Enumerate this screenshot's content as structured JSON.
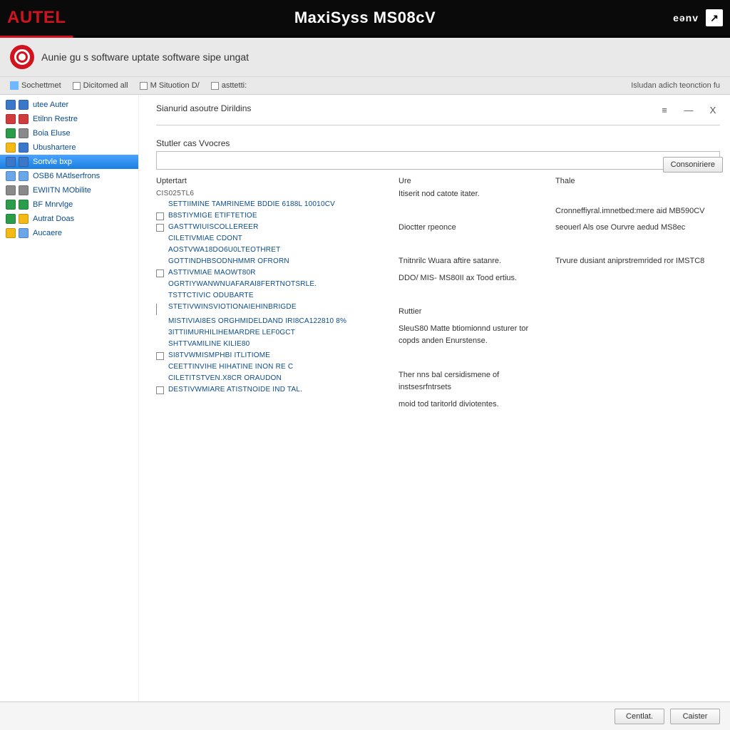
{
  "topbar": {
    "brand": "AUTEL",
    "title": "MaxiSyss MS08cV",
    "right_text": "eənv",
    "right_icon": "↗"
  },
  "subheader": {
    "title": "Aunie gu s software uptate software sipe ungat"
  },
  "toolbar": {
    "items": [
      {
        "label": "Sochettmet",
        "icon_color": "#6fb8ff"
      },
      {
        "label": "Dicitomed all",
        "checkbox": true
      },
      {
        "label": "M Situotion D/",
        "checkbox": true
      },
      {
        "label": "asttetti:",
        "checkbox": true
      }
    ],
    "right_text": "Isludan adich teonction fu"
  },
  "sidebar": {
    "items": [
      {
        "label": "utee Auter",
        "c1": "#3b78c9",
        "c2": "#3b78c9",
        "active": false
      },
      {
        "label": "Etilnn Restre",
        "c1": "#d23b3b",
        "c2": "#d23b3b",
        "active": false
      },
      {
        "label": "Boia Eluse",
        "c1": "#2a9c4a",
        "c2": "#8a8a8a",
        "active": false
      },
      {
        "label": "Ubushartere",
        "c1": "#f5b915",
        "c2": "#3b78c9",
        "active": false
      },
      {
        "label": "Sortvle bxp",
        "c1": "#3b78c9",
        "c2": "#3b78c9",
        "active": true
      },
      {
        "label": "OSB6 MAtlserfrons",
        "c1": "#6aa6e8",
        "c2": "#6aa6e8",
        "active": false
      },
      {
        "label": "EWIITN MObilite",
        "c1": "#8a8a8a",
        "c2": "#8a8a8a",
        "active": false
      },
      {
        "label": "BF Mnrvlge",
        "c1": "#2a9c4a",
        "c2": "#2a9c4a",
        "active": false
      },
      {
        "label": "Autrat Doas",
        "c1": "#2a9c4a",
        "c2": "#f5b915",
        "active": false
      },
      {
        "label": "Aucaere",
        "c1": "#f5b915",
        "c2": "#6aa6e8",
        "active": false
      }
    ]
  },
  "main": {
    "header": "Sianurid asoutre Dirildins",
    "section": "Stutler cas Vvocres",
    "col_left_head": "Uptertart",
    "col_mid_head": "Ure",
    "col_right_head": "Thale",
    "group": "CIS025TL6",
    "confirm_btn": "Consoniriere",
    "rows": [
      {
        "cb": "hidden",
        "label": "SETTIIMINE TAMRINEME BDDIE 6188L 10010CV"
      },
      {
        "cb": "show",
        "label": "B8STIYMIGE ETIFTETIOE"
      },
      {
        "cb": "show",
        "label": "GASTTWIUISCOllereer"
      },
      {
        "cb": "hidden",
        "label": "CILETIVMIAE CDONT"
      },
      {
        "cb": "hidden",
        "label": "AOSTVWA18DO6U0LTeothret"
      },
      {
        "cb": "hidden",
        "label": "GOTTINDHBSODNhmmr ofrorn"
      },
      {
        "cb": "show",
        "label": "ASTTIVMIAE MAOWT80R"
      },
      {
        "cb": "hidden",
        "label": "OGRTIYWANWNUAFARAI8Fertnotsrle."
      },
      {
        "cb": "hidden",
        "label": "TSTTCTIVIC ODUBARTE"
      },
      {
        "cb": "line",
        "label": "STETIVWINSVIOTIONAIEHInbrigde"
      },
      {
        "cb": "hidden",
        "label": "MISTIVIAI8ES ORGhmideldand Iri8cA122810 8%"
      },
      {
        "cb": "hidden",
        "label": "3ITTIIMURHILIHEmardre leF0GCT"
      },
      {
        "cb": "hidden",
        "label": "SHTTVAMILINE KILIE80"
      },
      {
        "cb": "show",
        "label": "SI8TVWMISMPHBI ITLITIOME"
      },
      {
        "cb": "hidden",
        "label": "CEETTINVIHE HIHatine inon re c"
      },
      {
        "cb": "hidden",
        "label": "CILETITSTVEN.X8cr oraudon"
      },
      {
        "cb": "show",
        "label": "DESTIVWMIARE atistnoide Ind tal."
      }
    ],
    "midrows": [
      "Itiserit nod catote itater.",
      "",
      "Dioctter rpeonce",
      "",
      "Tnitnrilc Wuara aftire satanre.",
      "DDO/ MIS- MS80II ax Tood ertius.",
      "",
      "Ruttier",
      "SleuS80 Matte btiomionnd usturer tor copds anden Enurstense.",
      "",
      "Ther nns bal cersidismene of instsesrfntrsets",
      "moid tod taritorld diviotentes."
    ],
    "rightrows": [
      "",
      "Cronneffiyral.imnetbed:mere aid MB590CV",
      "seouerl Als ose Ourvre aedud MS8ec",
      "",
      "Trvure dusiant aniprstremrided ror IMSTC8"
    ]
  },
  "footer": {
    "btn1": "Centlat.",
    "btn2": "Caister"
  }
}
